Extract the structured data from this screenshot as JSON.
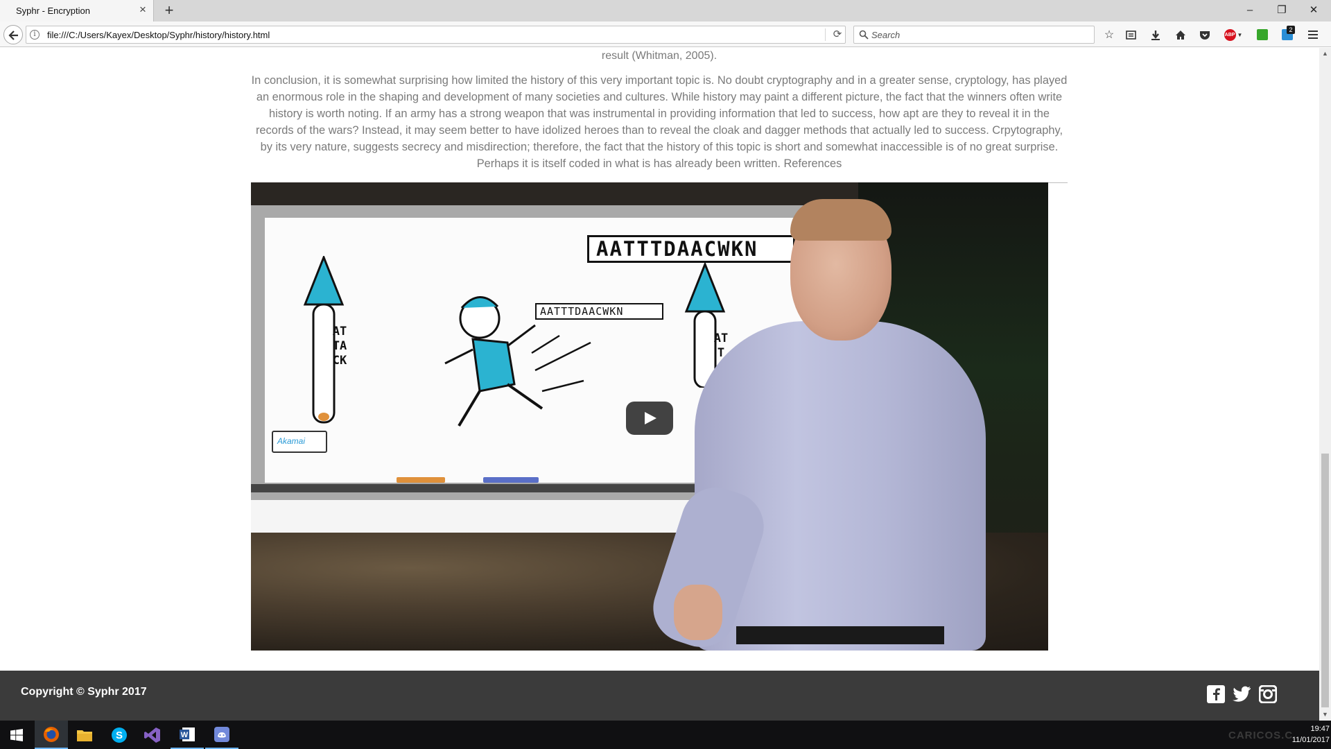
{
  "browser": {
    "tab_title": "Syphr - Encryption",
    "url": "file:///C:/Users/Kayex/Desktop/Syphr/history/history.html",
    "search_placeholder": "Search",
    "notification_count": "2",
    "abp_label": "ABP",
    "info_glyph": "i"
  },
  "page": {
    "prev_paragraph_tail": "result (Whitman, 2005).",
    "conclusion_paragraph": "In conclusion, it is somewhat surprising how limited the history of this very important topic is. No doubt cryptography and in a greater sense, cryptology, has played an enormous role in the shaping and development of many societies and cultures. While history may paint a different picture, the fact that the winners often write history is worth noting. If an army has a strong weapon that was instrumental in providing information that led to success, how apt are they to reveal it in the records of the wars? Instead, it may seem better to have idolized heroes than to reveal the cloak and dagger methods that actually led to success. Crpytography, by its very nature, suggests secrecy and misdirection; therefore, the fact that the history of this topic is short and somewhat inaccessible is of no great surprise. Perhaps it is itself coded in what is has already been written. References",
    "video": {
      "banner_text": "AATTTDAACWKN",
      "small_banner_text": "AATTTDAACWKN",
      "arrow_letters": "ATTACK",
      "arrow2_letters": "ATT",
      "akamai_label": "Akamai"
    }
  },
  "footer": {
    "copyright": "Copyright © Syphr 2017",
    "social": [
      "facebook-icon",
      "twitter-icon",
      "instagram-icon"
    ]
  },
  "taskbar": {
    "time": "19:47",
    "date": "11/01/2017",
    "watermark": "CARICOS.C"
  },
  "colors": {
    "footer_bg": "#3b3b3b",
    "body_text": "#7a7a7a",
    "taskbar_bg": "#101012",
    "accent": "#6eb6f5"
  }
}
